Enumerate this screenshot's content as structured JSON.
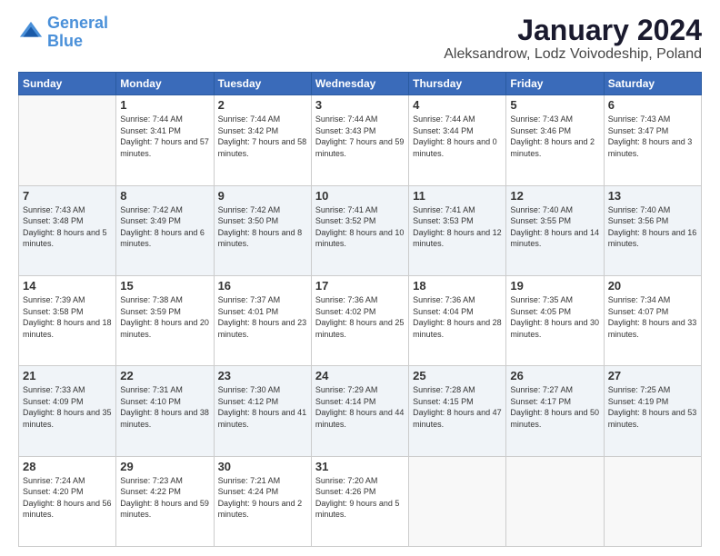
{
  "logo": {
    "line1": "General",
    "line2": "Blue"
  },
  "title": "January 2024",
  "subtitle": "Aleksandrow, Lodz Voivodeship, Poland",
  "days_header": [
    "Sunday",
    "Monday",
    "Tuesday",
    "Wednesday",
    "Thursday",
    "Friday",
    "Saturday"
  ],
  "weeks": [
    [
      {
        "day": "",
        "empty": true
      },
      {
        "day": "1",
        "sunrise": "7:44 AM",
        "sunset": "3:41 PM",
        "daylight": "7 hours and 57 minutes."
      },
      {
        "day": "2",
        "sunrise": "7:44 AM",
        "sunset": "3:42 PM",
        "daylight": "7 hours and 58 minutes."
      },
      {
        "day": "3",
        "sunrise": "7:44 AM",
        "sunset": "3:43 PM",
        "daylight": "7 hours and 59 minutes."
      },
      {
        "day": "4",
        "sunrise": "7:44 AM",
        "sunset": "3:44 PM",
        "daylight": "8 hours and 0 minutes."
      },
      {
        "day": "5",
        "sunrise": "7:43 AM",
        "sunset": "3:46 PM",
        "daylight": "8 hours and 2 minutes."
      },
      {
        "day": "6",
        "sunrise": "7:43 AM",
        "sunset": "3:47 PM",
        "daylight": "8 hours and 3 minutes."
      }
    ],
    [
      {
        "day": "7",
        "sunrise": "7:43 AM",
        "sunset": "3:48 PM",
        "daylight": "8 hours and 5 minutes."
      },
      {
        "day": "8",
        "sunrise": "7:42 AM",
        "sunset": "3:49 PM",
        "daylight": "8 hours and 6 minutes."
      },
      {
        "day": "9",
        "sunrise": "7:42 AM",
        "sunset": "3:50 PM",
        "daylight": "8 hours and 8 minutes."
      },
      {
        "day": "10",
        "sunrise": "7:41 AM",
        "sunset": "3:52 PM",
        "daylight": "8 hours and 10 minutes."
      },
      {
        "day": "11",
        "sunrise": "7:41 AM",
        "sunset": "3:53 PM",
        "daylight": "8 hours and 12 minutes."
      },
      {
        "day": "12",
        "sunrise": "7:40 AM",
        "sunset": "3:55 PM",
        "daylight": "8 hours and 14 minutes."
      },
      {
        "day": "13",
        "sunrise": "7:40 AM",
        "sunset": "3:56 PM",
        "daylight": "8 hours and 16 minutes."
      }
    ],
    [
      {
        "day": "14",
        "sunrise": "7:39 AM",
        "sunset": "3:58 PM",
        "daylight": "8 hours and 18 minutes."
      },
      {
        "day": "15",
        "sunrise": "7:38 AM",
        "sunset": "3:59 PM",
        "daylight": "8 hours and 20 minutes."
      },
      {
        "day": "16",
        "sunrise": "7:37 AM",
        "sunset": "4:01 PM",
        "daylight": "8 hours and 23 minutes."
      },
      {
        "day": "17",
        "sunrise": "7:36 AM",
        "sunset": "4:02 PM",
        "daylight": "8 hours and 25 minutes."
      },
      {
        "day": "18",
        "sunrise": "7:36 AM",
        "sunset": "4:04 PM",
        "daylight": "8 hours and 28 minutes."
      },
      {
        "day": "19",
        "sunrise": "7:35 AM",
        "sunset": "4:05 PM",
        "daylight": "8 hours and 30 minutes."
      },
      {
        "day": "20",
        "sunrise": "7:34 AM",
        "sunset": "4:07 PM",
        "daylight": "8 hours and 33 minutes."
      }
    ],
    [
      {
        "day": "21",
        "sunrise": "7:33 AM",
        "sunset": "4:09 PM",
        "daylight": "8 hours and 35 minutes."
      },
      {
        "day": "22",
        "sunrise": "7:31 AM",
        "sunset": "4:10 PM",
        "daylight": "8 hours and 38 minutes."
      },
      {
        "day": "23",
        "sunrise": "7:30 AM",
        "sunset": "4:12 PM",
        "daylight": "8 hours and 41 minutes."
      },
      {
        "day": "24",
        "sunrise": "7:29 AM",
        "sunset": "4:14 PM",
        "daylight": "8 hours and 44 minutes."
      },
      {
        "day": "25",
        "sunrise": "7:28 AM",
        "sunset": "4:15 PM",
        "daylight": "8 hours and 47 minutes."
      },
      {
        "day": "26",
        "sunrise": "7:27 AM",
        "sunset": "4:17 PM",
        "daylight": "8 hours and 50 minutes."
      },
      {
        "day": "27",
        "sunrise": "7:25 AM",
        "sunset": "4:19 PM",
        "daylight": "8 hours and 53 minutes."
      }
    ],
    [
      {
        "day": "28",
        "sunrise": "7:24 AM",
        "sunset": "4:20 PM",
        "daylight": "8 hours and 56 minutes."
      },
      {
        "day": "29",
        "sunrise": "7:23 AM",
        "sunset": "4:22 PM",
        "daylight": "8 hours and 59 minutes."
      },
      {
        "day": "30",
        "sunrise": "7:21 AM",
        "sunset": "4:24 PM",
        "daylight": "9 hours and 2 minutes."
      },
      {
        "day": "31",
        "sunrise": "7:20 AM",
        "sunset": "4:26 PM",
        "daylight": "9 hours and 5 minutes."
      },
      {
        "day": "",
        "empty": true
      },
      {
        "day": "",
        "empty": true
      },
      {
        "day": "",
        "empty": true
      }
    ]
  ]
}
